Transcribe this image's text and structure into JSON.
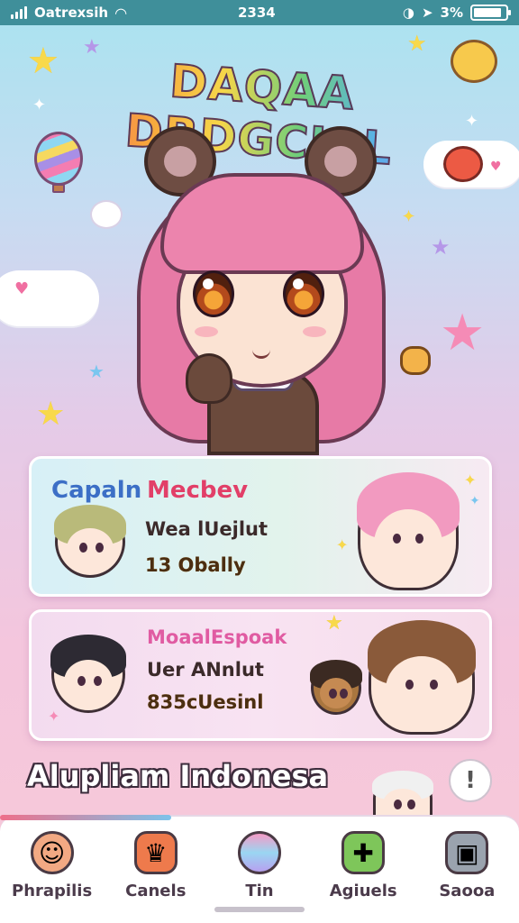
{
  "status_bar": {
    "carrier": "Oatrexsih",
    "time": "2334",
    "battery": "3%"
  },
  "app": {
    "title": "DAQAA DRDGCIAL"
  },
  "cards": [
    {
      "title_a": "Capaln",
      "title_b": "Mecbev",
      "line_1": "Wea lUejlut",
      "line_2": "13 Obally"
    },
    {
      "title": "MoaalEspoak",
      "line_1": "Uer ANnlut",
      "line_2": "835cUesinl"
    }
  ],
  "section": {
    "title": "Alupliam Indonesa",
    "info_icon": "!"
  },
  "tabs": [
    {
      "label": "Phrapilis",
      "icon": "person-icon"
    },
    {
      "label": "Canels",
      "icon": "crown-icon"
    },
    {
      "label": "Tin",
      "icon": "orb-icon"
    },
    {
      "label": "Agiuels",
      "icon": "gift-icon"
    },
    {
      "label": "Saooa",
      "icon": "box-icon"
    }
  ],
  "colors": {
    "status_bar": "#3f8f9a",
    "title_gradient": [
      "#f05a93",
      "#f7a13c",
      "#f6d649",
      "#6fce7a",
      "#58b0ea",
      "#a07be0"
    ],
    "card_title_blue": "#3c6fc6",
    "card_title_red": "#e23f68"
  }
}
